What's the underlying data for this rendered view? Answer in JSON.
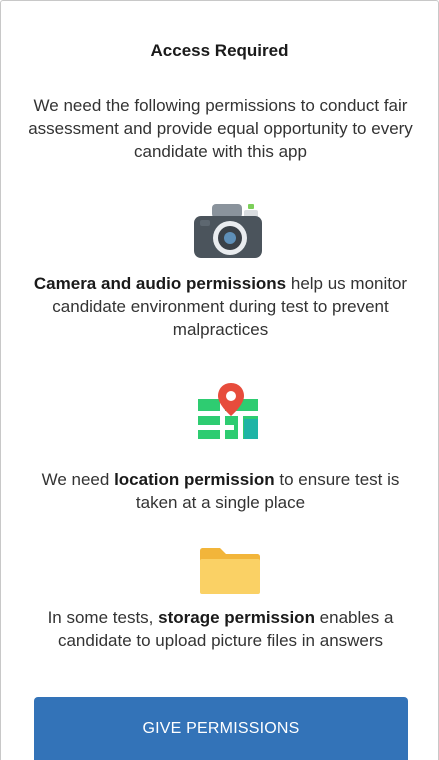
{
  "dialog": {
    "title": "Access Required",
    "intro": "We need the following permissions to conduct fair assessment and provide equal opportunity to every candidate with this app"
  },
  "permissions": [
    {
      "icon": "camera-icon",
      "lead": "",
      "bold": "Camera and audio permissions",
      "trail": " help us monitor candidate environment during test to prevent malpractices"
    },
    {
      "icon": "map-pin-icon",
      "lead": "We need ",
      "bold": "location permission",
      "trail": " to ensure test is taken at a single place"
    },
    {
      "icon": "folder-icon",
      "lead": "In some tests, ",
      "bold": "storage permission",
      "trail": " enables a candidate to upload picture files in answers"
    }
  ],
  "action": {
    "label": "GIVE PERMISSIONS"
  },
  "colors": {
    "button": "#3373b8",
    "map_green": "#2ecc71",
    "pin_red": "#e74c3c",
    "folder_yellow": "#f9c74f"
  }
}
